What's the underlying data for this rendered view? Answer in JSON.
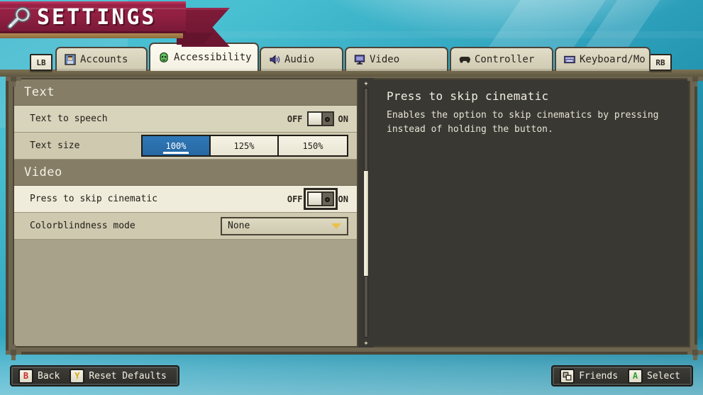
{
  "window": {
    "title": "SETTINGS",
    "title_icon": "wrench-icon"
  },
  "tabs": {
    "left_bumper": "LB",
    "right_bumper": "RB",
    "items": [
      {
        "label": "Accounts",
        "icon": "account-avatar-icon",
        "active": false
      },
      {
        "label": "Accessibility",
        "icon": "accessibility-head-icon",
        "active": true
      },
      {
        "label": "Audio",
        "icon": "speaker-icon",
        "active": false
      },
      {
        "label": "Video",
        "icon": "monitor-icon",
        "active": false
      },
      {
        "label": "Controller",
        "icon": "gamepad-icon",
        "active": false
      },
      {
        "label": "Keyboard/Mo",
        "icon": "keyboard-icon",
        "active": false
      }
    ]
  },
  "settings_list": {
    "sections": [
      {
        "title": "Text",
        "rows": [
          {
            "label": "Text to speech",
            "control": "toggle",
            "off_label": "OFF",
            "on_label": "ON",
            "value": "OFF",
            "focused": false
          },
          {
            "label": "Text size",
            "control": "segmented",
            "options": [
              "100%",
              "125%",
              "150%"
            ],
            "value": "100%"
          }
        ]
      },
      {
        "title": "Video",
        "rows": [
          {
            "label": "Press to skip cinematic",
            "control": "toggle",
            "off_label": "OFF",
            "on_label": "ON",
            "value": "OFF",
            "focused": true
          },
          {
            "label": "Colorblindness mode",
            "control": "dropdown",
            "value": "None"
          }
        ]
      }
    ]
  },
  "description": {
    "title": "Press to skip cinematic",
    "body": "Enables the option to skip cinematics by pressing instead of holding the button."
  },
  "scrollbar": {
    "up_glyph": "✦",
    "down_glyph": "✦"
  },
  "hints": {
    "left": [
      {
        "key": "B",
        "key_style": "k-b",
        "label": "Back"
      },
      {
        "key": "Y",
        "key_style": "k-y",
        "label": "Reset Defaults"
      }
    ],
    "right": [
      {
        "key": "friends-icon",
        "key_style": "k-icon",
        "label": "Friends"
      },
      {
        "key": "A",
        "key_style": "k-a",
        "label": "Select"
      }
    ]
  },
  "colors": {
    "accent_blue": "#2f78b7",
    "banner_red": "#8e1f41",
    "panel_tan": "#a9a28b",
    "panel_dark": "#3a3833",
    "dropdown_arrow_gold": "#e9c04b",
    "key_b_red": "#c92b2b",
    "key_y_gold": "#d9a81b",
    "key_a_green": "#2f9e3a"
  }
}
